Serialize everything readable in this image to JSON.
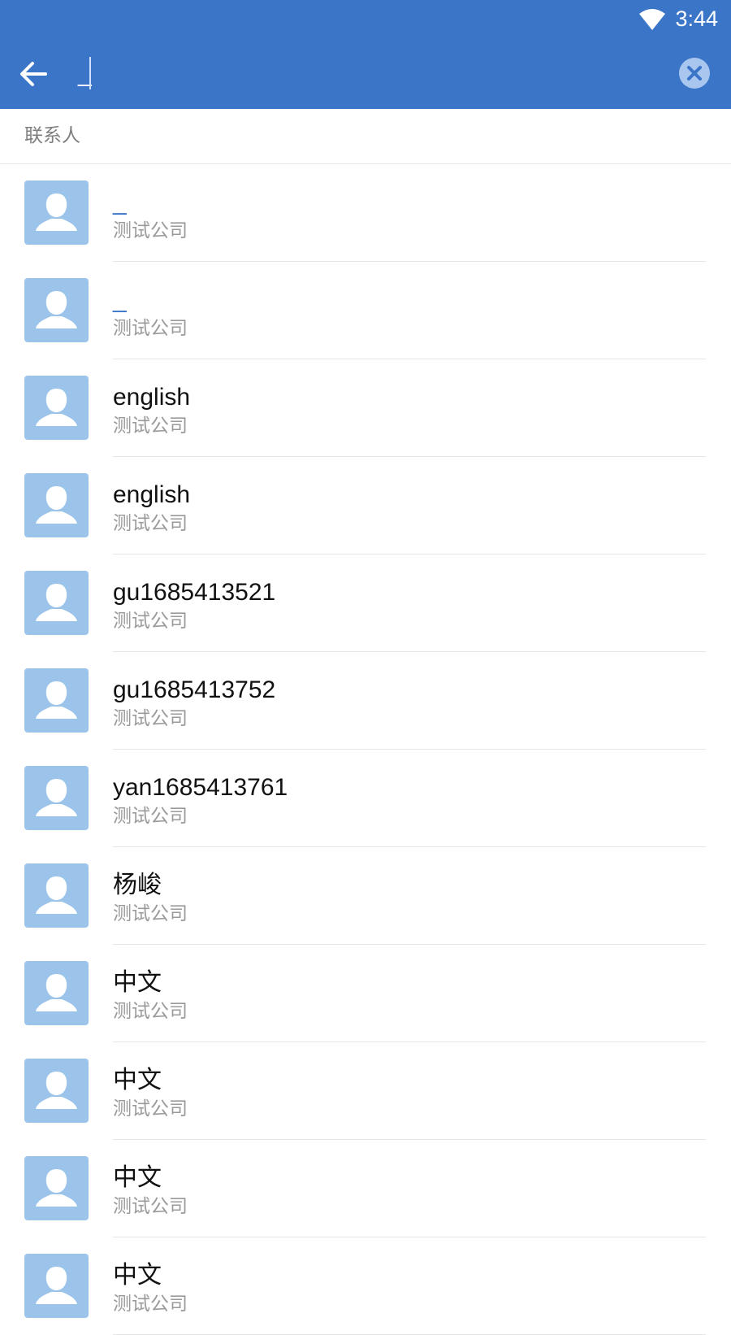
{
  "status_bar": {
    "time": "3:44"
  },
  "search": {
    "value": "_"
  },
  "section": {
    "title": "联系人"
  },
  "contacts": [
    {
      "name": "_",
      "company": "测试公司",
      "highlight": true
    },
    {
      "name": "_",
      "company": "测试公司",
      "highlight": true
    },
    {
      "name": "english",
      "company": "测试公司",
      "highlight": false
    },
    {
      "name": "english",
      "company": "测试公司",
      "highlight": false
    },
    {
      "name": "gu1685413521",
      "company": "测试公司",
      "highlight": false
    },
    {
      "name": "gu1685413752",
      "company": "测试公司",
      "highlight": false
    },
    {
      "name": "yan1685413761",
      "company": "测试公司",
      "highlight": false
    },
    {
      "name": "杨峻",
      "company": "测试公司",
      "highlight": false
    },
    {
      "name": "中文",
      "company": "测试公司",
      "highlight": false
    },
    {
      "name": "中文",
      "company": "测试公司",
      "highlight": false
    },
    {
      "name": "中文",
      "company": "测试公司",
      "highlight": false
    },
    {
      "name": "中文",
      "company": "测试公司",
      "highlight": false
    }
  ],
  "colors": {
    "primary": "#3a75c8",
    "avatar_bg": "#9cc4ea",
    "highlight_text": "#3a75c8"
  },
  "icons": {
    "back": "arrow-left-icon",
    "clear": "close-circle-icon",
    "wifi": "wifi-icon",
    "avatar": "person-icon"
  }
}
